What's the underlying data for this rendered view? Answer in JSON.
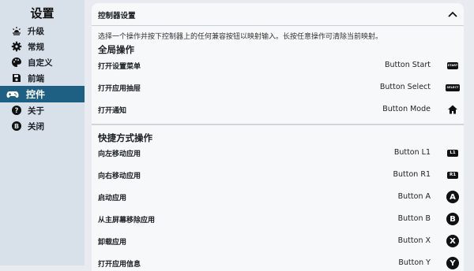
{
  "sidebar": {
    "title": "设置",
    "items": [
      {
        "label": "升级",
        "icon": "sunrise-icon"
      },
      {
        "label": "常规",
        "icon": "gear-icon"
      },
      {
        "label": "自定义",
        "icon": "palette-icon"
      },
      {
        "label": "前端",
        "icon": "save-icon"
      },
      {
        "label": "控件",
        "icon": "gamepad-icon"
      },
      {
        "label": "关于",
        "icon": "help-icon"
      },
      {
        "label": "关闭",
        "icon": "close-b-icon"
      }
    ],
    "active_index": 4
  },
  "panel": {
    "title": "控制器设置",
    "description": "选择一个操作并按下控制器上的任何兼容按钮以映射输入。长按任意操作可清除当前映射。",
    "global": {
      "title": "全局操作",
      "rows": [
        {
          "label": "打开设置菜单",
          "value": "Button Start",
          "icon_text": "START"
        },
        {
          "label": "打开应用抽屉",
          "value": "Button Select",
          "icon_text": "SELECT"
        },
        {
          "label": "打开通知",
          "value": "Button Mode",
          "icon": "home-icon"
        }
      ]
    },
    "shortcuts": {
      "title": "快捷方式操作",
      "rows": [
        {
          "label": "向左移动应用",
          "value": "Button L1",
          "icon_text": "L1"
        },
        {
          "label": "向右移动应用",
          "value": "Button R1",
          "icon_text": "R1"
        },
        {
          "label": "启动应用",
          "value": "Button A",
          "icon_text": "A"
        },
        {
          "label": "从主屏幕移除应用",
          "value": "Button B",
          "icon_text": "B"
        },
        {
          "label": "卸载应用",
          "value": "Button X",
          "icon_text": "X"
        },
        {
          "label": "打开应用信息",
          "value": "Button Y",
          "icon_text": "Y"
        }
      ]
    }
  },
  "colors": {
    "sidebar_bg": "#d8e0ea",
    "active_bg": "#1e5f84",
    "panel_bg": "#f6f8fa",
    "page_bg": "#e8ecf1"
  }
}
